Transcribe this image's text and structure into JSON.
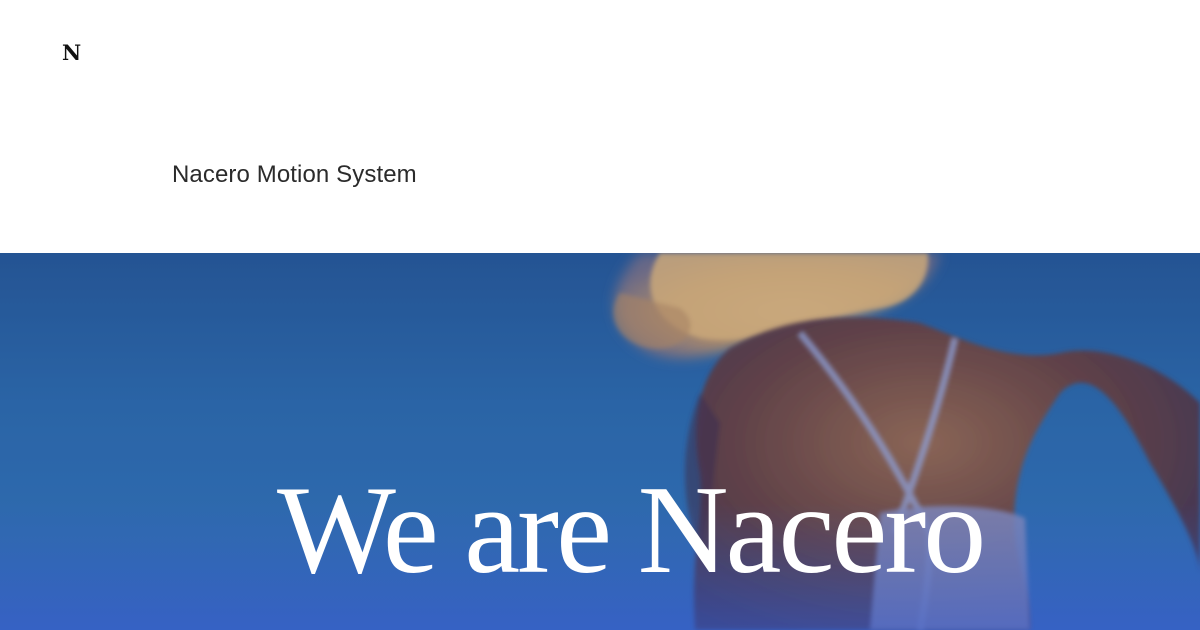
{
  "header": {
    "logo_text": "N",
    "site_title": "Nacero Motion System"
  },
  "hero": {
    "heading": "We are Nacero",
    "image_description_icon": "woman-dancing-photo",
    "background_color": "#2a66a8",
    "text_color": "#ffffff"
  }
}
